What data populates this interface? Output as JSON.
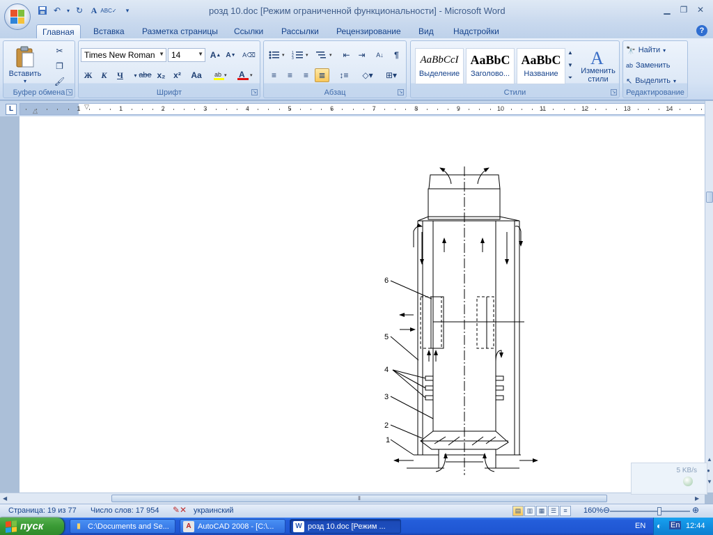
{
  "window": {
    "title": "розд 10.doc [Режим ограниченной функциональности] - Microsoft Word"
  },
  "tabs": [
    {
      "label": "Главная",
      "active": true
    },
    {
      "label": "Вставка"
    },
    {
      "label": "Разметка страницы"
    },
    {
      "label": "Ссылки"
    },
    {
      "label": "Рассылки"
    },
    {
      "label": "Рецензирование"
    },
    {
      "label": "Вид"
    },
    {
      "label": "Надстройки"
    }
  ],
  "ribbon": {
    "clipboard": {
      "label": "Буфер обмена",
      "paste": "Вставить"
    },
    "font": {
      "label": "Шрифт",
      "name": "Times New Roman",
      "size": "14",
      "bold": "Ж",
      "italic": "К",
      "underline": "Ч",
      "strike": "abe",
      "sub": "x₂",
      "sup": "x²",
      "case": "Aa"
    },
    "paragraph": {
      "label": "Абзац"
    },
    "styles": {
      "label": "Стили",
      "items": [
        {
          "preview": "AaBbCcI",
          "name": "Выделение"
        },
        {
          "preview": "AaBbC",
          "name": "Заголово..."
        },
        {
          "preview": "AaBbC",
          "name": "Название"
        }
      ],
      "change": "Изменить стили"
    },
    "editing": {
      "label": "Редактирование",
      "find": "Найти",
      "replace": "Заменить",
      "select": "Выделить"
    }
  },
  "ruler": {
    "numbers": [
      "1",
      "1",
      "2",
      "3",
      "4",
      "5",
      "6",
      "7",
      "8",
      "9",
      "10",
      "11",
      "12",
      "13",
      "14",
      "15"
    ]
  },
  "drawing": {
    "labels": [
      "6",
      "5",
      "4",
      "3",
      "2",
      "1"
    ]
  },
  "netwidget": {
    "rate": "5 KB/s"
  },
  "status": {
    "page": "Страница: 19 из 77",
    "words": "Число слов: 17 954",
    "lang": "украинский",
    "zoom": "160%"
  },
  "taskbar": {
    "start": "пуск",
    "tasks": [
      {
        "label": "C:\\Documents and Se..."
      },
      {
        "label": "AutoCAD 2008 - [C:\\..."
      },
      {
        "label": "розд 10.doc [Режим ..."
      }
    ],
    "lang": "EN",
    "tray_lang": "En",
    "clock": "12:44"
  },
  "colors": {
    "accent": "#15428b",
    "taskbar": "#245edb",
    "start": "#3a9a35"
  }
}
